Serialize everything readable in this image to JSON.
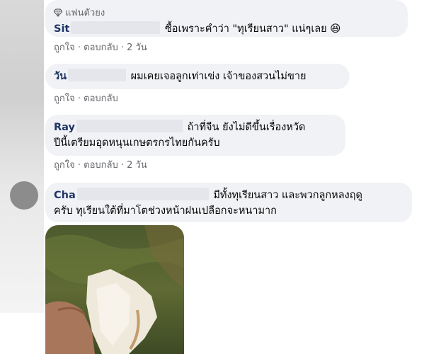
{
  "comments": [
    {
      "badge": "แฟนตัวยง",
      "name_visible": "Sit",
      "text_line1": "ซื้อเพราะคำว่า \"ทุเรียนสาว\" แน่ๆเลย 😆",
      "actions": {
        "like": "ถูกใจ",
        "reply": "ตอบกลับ",
        "age": "2 วัน"
      }
    },
    {
      "name_visible": "วัน",
      "text_line1": "ผมเคยเจอลูกเท่าเข่ง เจ้าของสวนไม่ขาย",
      "actions": {
        "like": "ถูกใจ",
        "reply": "ตอบกลับ"
      }
    },
    {
      "name_visible": "Ray",
      "text_line1": "ถ้าที่จีน ยังไม่ดีขึ้นเรื่องหวัด",
      "text_line2": "ปีนี้เตรียมอุดหนุนเกษตรกรไทยกันครับ",
      "actions": {
        "like": "ถูกใจ",
        "reply": "ตอบกลับ",
        "age": "2 วัน"
      }
    },
    {
      "name_visible": "Cha",
      "text_line1": "มีทั้งทุเรียนสาว และพวกลูกหลงฤดู",
      "text_line2": "ครับ ทุเรียนใต้ที่มาโตช่วงหน้าฝนเปลือกจะหนามาก"
    }
  ],
  "separator": " · "
}
